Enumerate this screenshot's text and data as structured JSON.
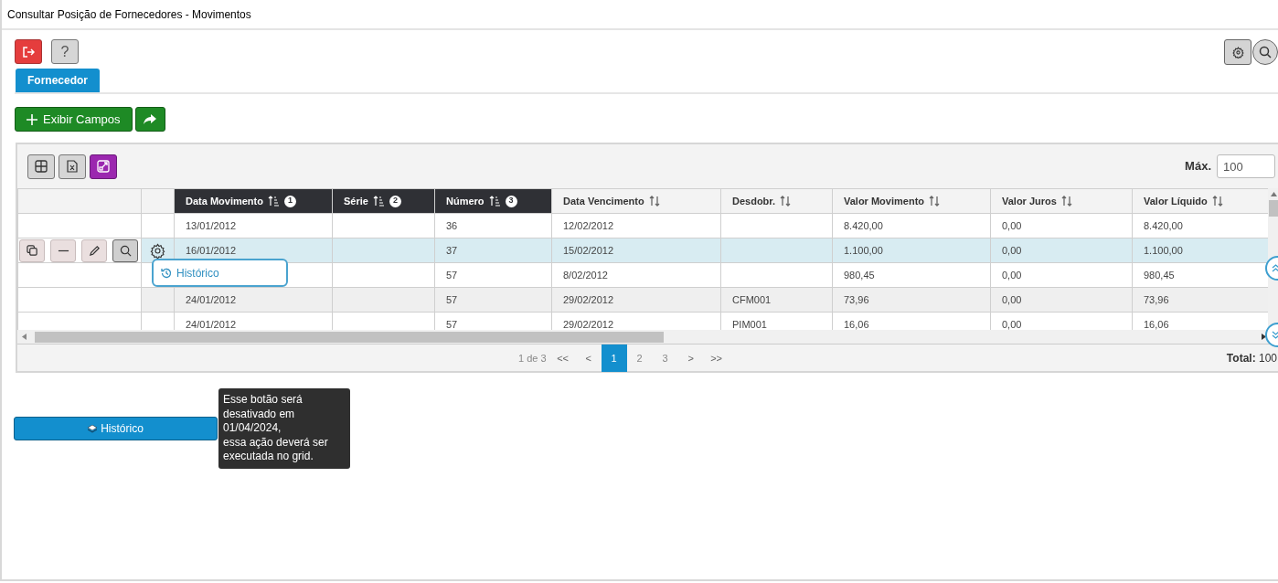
{
  "window": {
    "title": "Consultar Posição de Fornecedores - Movimentos"
  },
  "toolbar": {
    "help_label": "?"
  },
  "tabs": [
    {
      "label": "Fornecedor",
      "selected": true
    }
  ],
  "actions": {
    "show_fields": "Exibir Campos"
  },
  "grid": {
    "max_label": "Máx.",
    "max_value": "100",
    "columns": [
      {
        "label": "Data Movimento",
        "sort_order": "1",
        "sorted": true
      },
      {
        "label": "Série",
        "sort_order": "2",
        "sorted": true
      },
      {
        "label": "Número",
        "sort_order": "3",
        "sorted": true
      },
      {
        "label": "Data Vencimento",
        "sorted": false
      },
      {
        "label": "Desdobr.",
        "sorted": false
      },
      {
        "label": "Valor Movimento",
        "sorted": false
      },
      {
        "label": "Valor Juros",
        "sorted": false
      },
      {
        "label": "Valor Líquido",
        "sorted": false
      }
    ],
    "rows": [
      {
        "selected": false,
        "shaded": false,
        "cells": [
          "13/01/2012",
          "",
          "36",
          "12/02/2012",
          "",
          "8.420,00",
          "0,00",
          "8.420,00"
        ]
      },
      {
        "selected": true,
        "shaded": false,
        "cells": [
          "16/01/2012",
          "",
          "37",
          "15/02/2012",
          "",
          "1.100,00",
          "0,00",
          "1.100,00"
        ]
      },
      {
        "selected": false,
        "shaded": false,
        "cells": [
          "",
          "",
          "57",
          "8/02/2012",
          "",
          "980,45",
          "0,00",
          "980,45"
        ]
      },
      {
        "selected": false,
        "shaded": true,
        "cells": [
          "24/01/2012",
          "",
          "57",
          "29/02/2012",
          "CFM001",
          "73,96",
          "0,00",
          "73,96"
        ]
      },
      {
        "selected": false,
        "shaded": false,
        "cells": [
          "24/01/2012",
          "",
          "57",
          "29/02/2012",
          "PIM001",
          "16,06",
          "0,00",
          "16,06"
        ]
      }
    ],
    "row_actions": [
      {
        "kind": "copy",
        "selected": false
      },
      {
        "kind": "remove",
        "selected": false
      },
      {
        "kind": "edit",
        "selected": false
      },
      {
        "kind": "view",
        "selected": true
      }
    ],
    "context_menu": {
      "item": "Histórico"
    },
    "pagination": {
      "summary": "1 de 3",
      "first": "<<",
      "prev": "<",
      "pages": [
        {
          "label": "1",
          "selected": true
        },
        {
          "label": "2",
          "selected": false
        },
        {
          "label": "3",
          "selected": false
        }
      ],
      "next": ">",
      "last": ">>",
      "total": "**Total:** 100"
    }
  },
  "history_button": {
    "label": "Histórico"
  },
  "tooltip": {
    "lines": [
      "Esse botão será",
      "desativado em",
      "01/04/2024,",
      "essa ação deverá ser",
      "executada no grid."
    ]
  }
}
